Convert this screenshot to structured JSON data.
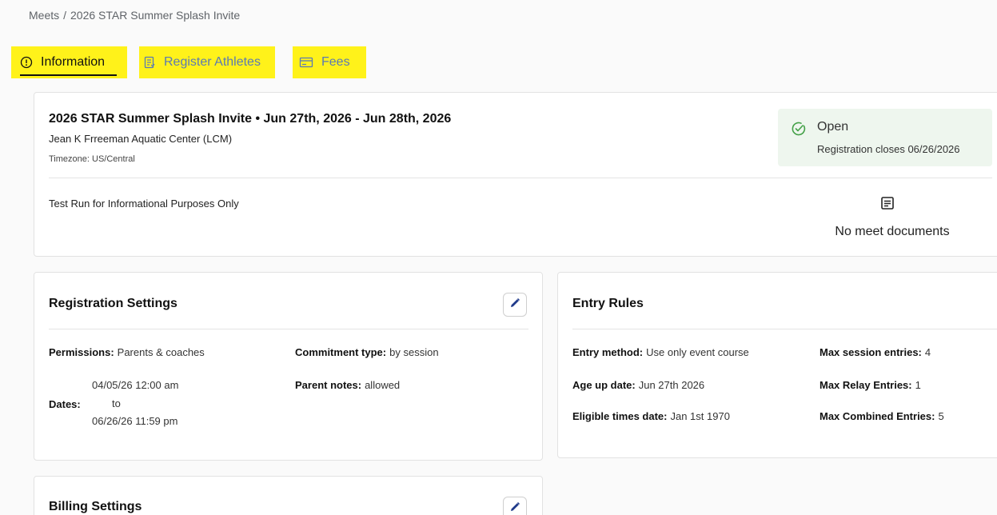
{
  "breadcrumb": {
    "parent": "Meets",
    "separator": "/",
    "current": "2026 STAR Summer Splash Invite"
  },
  "tabs": [
    {
      "label": "Information",
      "icon": "info-circle-icon",
      "active": true
    },
    {
      "label": "Register Athletes",
      "icon": "register-list-icon",
      "active": false
    },
    {
      "label": "Fees",
      "icon": "credit-card-icon",
      "active": false
    }
  ],
  "meet": {
    "title": "2026 STAR Summer Splash Invite • Jun 27th, 2026 - Jun 28th, 2026",
    "venue": "Jean K Frreeman Aquatic Center (LCM)",
    "timezone": "Timezone: US/Central",
    "description": "Test Run for Informational Purposes Only",
    "status": "Open",
    "status_sub": "Registration closes 06/26/2026",
    "documents_label": "No meet documents"
  },
  "registration_settings": {
    "title": "Registration Settings",
    "permissions_label": "Permissions:",
    "permissions_value": "Parents & coaches",
    "commitment_label": "Commitment type:",
    "commitment_value": "by session",
    "dates_label": "Dates:",
    "date_start": "04/05/26 12:00 am",
    "date_to": "to",
    "date_end": "06/26/26 11:59 pm",
    "parent_notes_label": "Parent notes:",
    "parent_notes_value": "allowed"
  },
  "entry_rules": {
    "title": "Entry Rules",
    "entry_method_label": "Entry method:",
    "entry_method_value": "Use only event course",
    "age_up_label": "Age up date:",
    "age_up_value": "Jun 27th 2026",
    "eligible_label": "Eligible times date:",
    "eligible_value": "Jan 1st 1970",
    "max_session_label": "Max session entries:",
    "max_session_value": "4",
    "max_relay_label": "Max Relay Entries:",
    "max_relay_value": "1",
    "max_combined_label": "Max Combined Entries:",
    "max_combined_value": "5"
  },
  "billing_settings": {
    "title": "Billing Settings"
  },
  "colors": {
    "highlight": "#fff21a",
    "link": "#5b7ab3",
    "open_green": "#43a047",
    "status_bg": "#eef6ee"
  }
}
